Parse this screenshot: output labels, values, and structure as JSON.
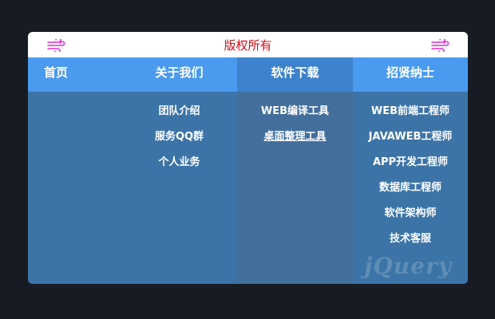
{
  "header": {
    "title": "版权所有",
    "left_icon": "wind-icon",
    "right_icon": "wind-icon",
    "icon_color": "#e12fd0",
    "title_color": "#d0101a"
  },
  "nav": {
    "home": {
      "label": "首页"
    },
    "about": {
      "label": "关于我们",
      "items": [
        "团队介绍",
        "服务QQ群",
        "个人业务"
      ]
    },
    "software": {
      "label": "软件下载",
      "items": [
        "WEB编译工具",
        "桌面整理工具"
      ]
    },
    "jobs": {
      "label": "招贤纳士",
      "items": [
        "WEB前端工程师",
        "JAVAWEB工程师",
        "APP开发工程师",
        "数据库工程师",
        "软件架构师",
        "技术客服"
      ]
    }
  },
  "colors": {
    "nav_bar": "#4a9af0",
    "active_column": "#3d82cc",
    "panel": "#3c74a7",
    "page_background": "#171b24"
  }
}
